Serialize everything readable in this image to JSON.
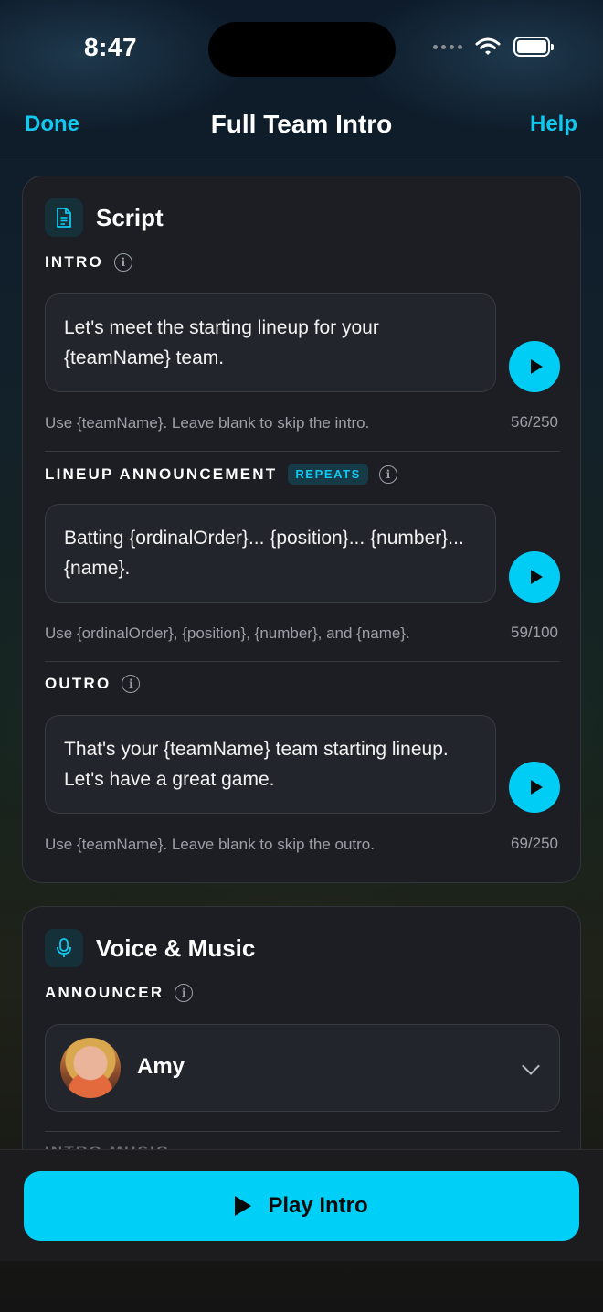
{
  "status_bar": {
    "time": "8:47"
  },
  "nav": {
    "left": "Done",
    "title": "Full Team Intro",
    "right": "Help"
  },
  "script_card": {
    "title": "Script",
    "sections": [
      {
        "label": "INTRO",
        "text": "Let's meet the starting lineup for your {teamName} team.",
        "hint": "Use {teamName}. Leave blank to skip the intro.",
        "count": "56/250"
      },
      {
        "label": "LINEUP ANNOUNCEMENT",
        "badge": "REPEATS",
        "text": "Batting {ordinalOrder}... {position}... {number}... {name}.",
        "hint": "Use {ordinalOrder}, {position}, {number}, and {name}.",
        "count": "59/100"
      },
      {
        "label": "OUTRO",
        "text": "That's your {teamName} team starting lineup. Let's have a great game.",
        "hint": "Use {teamName}. Leave blank to skip the outro.",
        "count": "69/250"
      }
    ]
  },
  "voice_card": {
    "title": "Voice & Music",
    "announcer_label": "ANNOUNCER",
    "announcer_name": "Amy",
    "next_label_partial": "INTRO MUSIC"
  },
  "bottom": {
    "play_label": "Play Intro"
  },
  "colors": {
    "accent": "#00d0f8",
    "card_bg": "#1c1e24"
  }
}
